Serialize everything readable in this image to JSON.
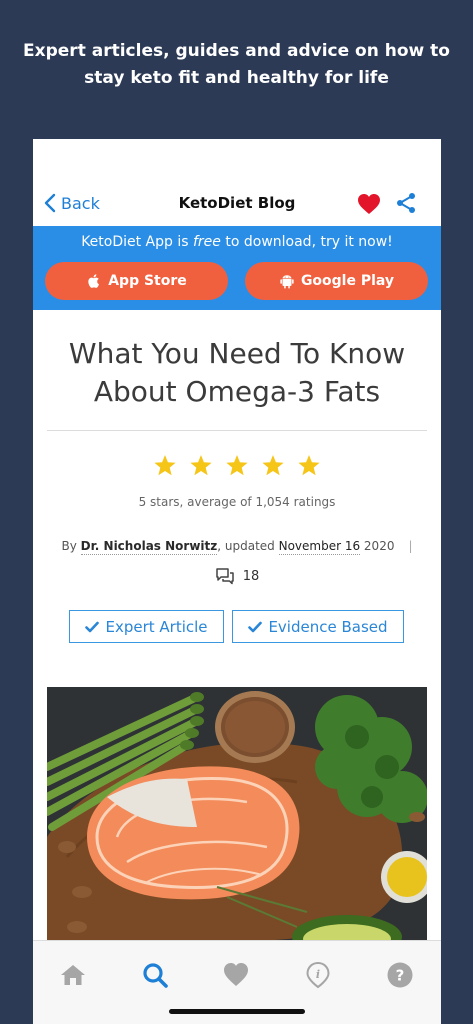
{
  "caption": "Expert articles, guides and advice on how to stay keto fit and healthy for life",
  "navbar": {
    "back_label": "Back",
    "title": "KetoDiet Blog"
  },
  "promo": {
    "text_before": "KetoDiet App is ",
    "text_emph": "free",
    "text_after": " to download, try it now!",
    "app_store_label": "App Store",
    "google_play_label": "Google Play"
  },
  "article": {
    "title": "What You Need To Know About Omega-3 Fats",
    "star_count": 5,
    "rating_text": "5 stars, average of 1,054 ratings",
    "by": "By ",
    "author": "Dr. Nicholas Norwitz",
    "updated": ", updated ",
    "date": "November 16",
    "year": " 2020",
    "separator": "|",
    "comment_count": "18",
    "tags": [
      "Expert Article",
      "Evidence Based"
    ]
  },
  "tabs": [
    "home",
    "search",
    "favorites",
    "info",
    "help"
  ],
  "colors": {
    "background": "#2c3a55",
    "accent_blue": "#2a8ee6",
    "store_button": "#f1603e",
    "star": "#f5c518",
    "heart": "#e3152b"
  },
  "icons": [
    "back-chevron-icon",
    "heart-icon",
    "share-icon",
    "apple-icon",
    "android-icon",
    "star-icon",
    "comment-icon",
    "check-icon",
    "home-icon",
    "search-icon",
    "heart-tab-icon",
    "info-icon",
    "help-icon"
  ]
}
